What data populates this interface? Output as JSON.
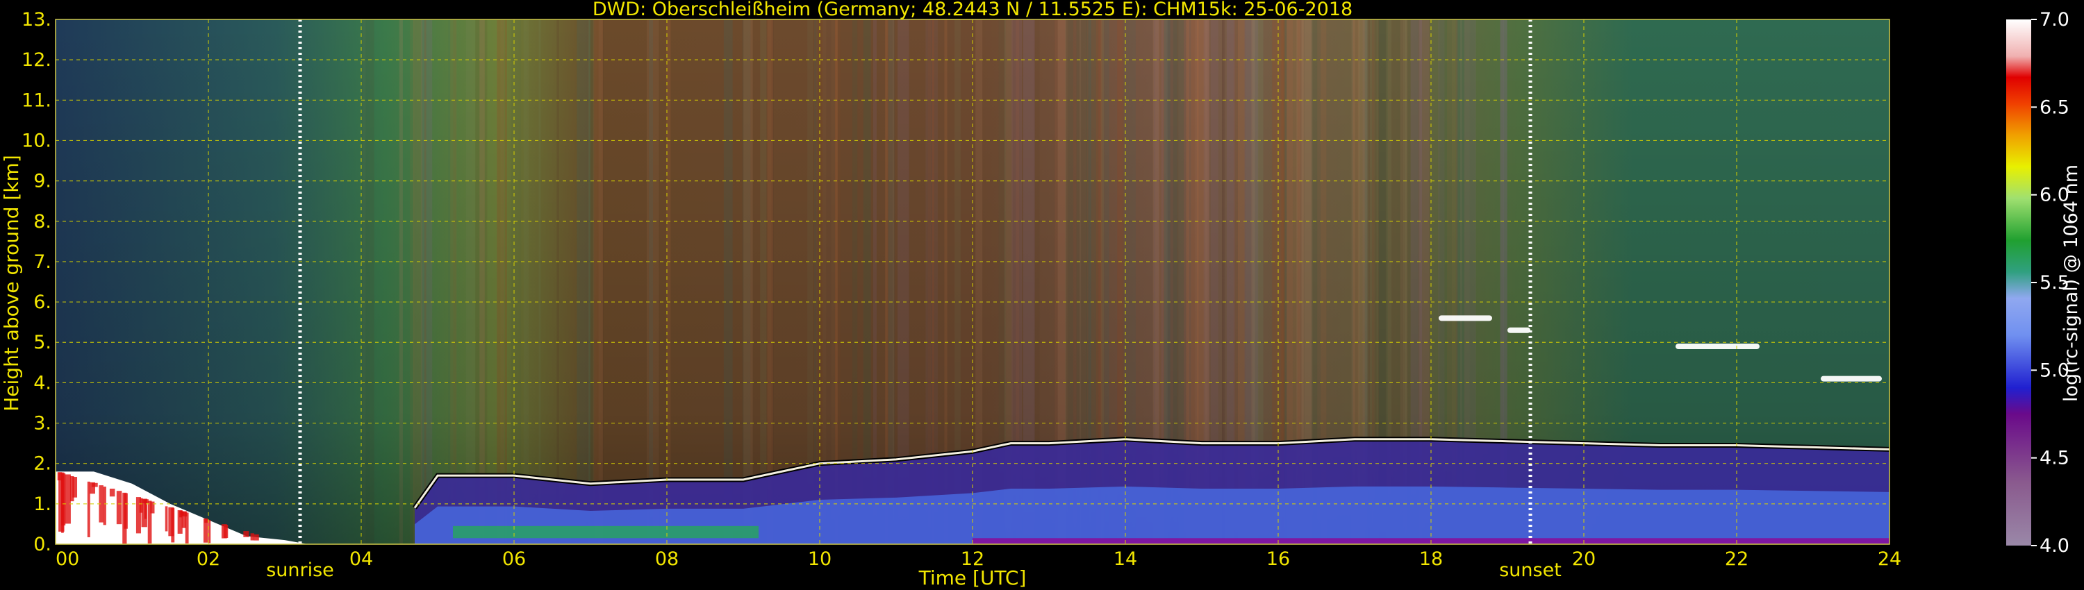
{
  "chart_data": {
    "type": "heatmap",
    "title": "DWD: Oberschleißheim (Germany; 48.2443 N / 11.5525 E):    CHM15k: 25-06-2018",
    "xlabel": "Time [UTC]",
    "ylabel": "Height above ground [km]",
    "xlim": [
      0,
      24
    ],
    "ylim": [
      0,
      13
    ],
    "x_ticks": [
      "00",
      "02",
      "04",
      "06",
      "08",
      "10",
      "12",
      "14",
      "16",
      "18",
      "20",
      "22",
      "24"
    ],
    "y_ticks": [
      "0.",
      "1.",
      "2.",
      "3.",
      "4.",
      "5.",
      "6.",
      "7.",
      "8.",
      "9.",
      "10.",
      "11.",
      "12.",
      "13."
    ],
    "grid": true,
    "colorbar": {
      "label": "log(rc-signal) @ 1064 nm",
      "range": [
        4.0,
        7.0
      ],
      "ticks": [
        "4.0",
        "4.5",
        "5.0",
        "5.5",
        "6.0",
        "6.5",
        "7.0"
      ]
    },
    "annotations": [
      {
        "label": "sunrise",
        "x": 3.2
      },
      {
        "label": "sunset",
        "x": 19.3
      }
    ],
    "boundary_layer_top_km": {
      "x": [
        4.7,
        5.0,
        6.0,
        7.0,
        8.0,
        9.0,
        10.0,
        11.0,
        12.0,
        12.5,
        13.0,
        14.0,
        15.0,
        16.0,
        17.0,
        18.0,
        19.0,
        20.0,
        21.0,
        22.0,
        23.0,
        24.0
      ],
      "y": [
        0.9,
        1.7,
        1.7,
        1.5,
        1.6,
        1.6,
        2.0,
        2.1,
        2.3,
        2.5,
        2.5,
        2.6,
        2.5,
        2.5,
        2.6,
        2.6,
        2.55,
        2.5,
        2.45,
        2.45,
        2.4,
        2.35
      ]
    },
    "night_low_cloud_km": {
      "x": [
        0,
        0.5,
        1.0,
        1.5,
        2.0,
        2.5,
        3.0,
        3.3
      ],
      "y": [
        1.8,
        1.8,
        1.5,
        1.0,
        0.6,
        0.2,
        0.1,
        0.0
      ]
    },
    "elevated_cloud_layers": [
      {
        "x_start": 18.1,
        "x_end": 18.8,
        "height_km": 5.6
      },
      {
        "x_start": 19.0,
        "x_end": 19.3,
        "height_km": 5.3
      },
      {
        "x_start": 21.2,
        "x_end": 22.3,
        "height_km": 4.9
      },
      {
        "x_start": 23.1,
        "x_end": 23.9,
        "height_km": 4.1
      }
    ]
  }
}
